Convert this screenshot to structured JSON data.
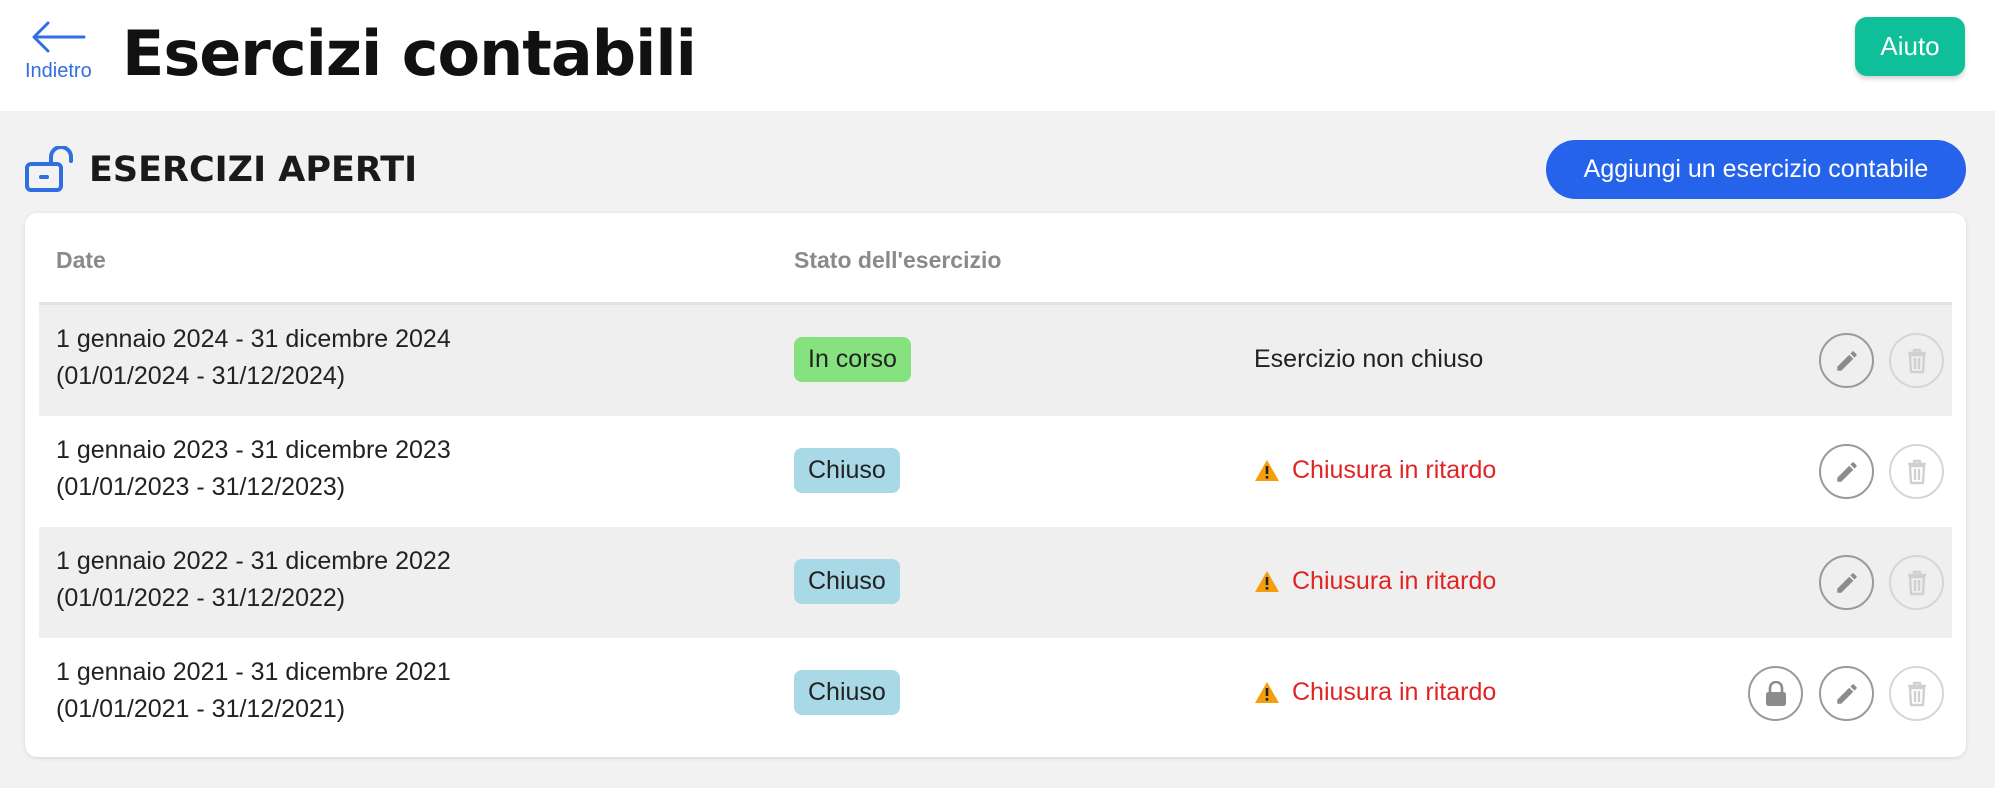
{
  "header": {
    "back_label": "Indietro",
    "title": "Esercizi contabili",
    "help_label": "Aiuto"
  },
  "section": {
    "title": "ESERCIZI APERTI",
    "add_button": "Aggiungi un esercizio contabile",
    "icon": "unlock-icon"
  },
  "table": {
    "headers": [
      "Date",
      "Stato dell'esercizio"
    ],
    "rows": [
      {
        "date_long": "1 gennaio 2024 - 31 dicembre 2024",
        "date_short": "(01/01/2024 - 31/12/2024)",
        "status": "In corso",
        "status_color": "#86e17f",
        "note": "Esercizio non chiuso",
        "warning": false,
        "lock": false
      },
      {
        "date_long": "1 gennaio 2023 - 31 dicembre 2023",
        "date_short": "(01/01/2023 - 31/12/2023)",
        "status": "Chiuso",
        "status_color": "#a9d8e6",
        "note": "Chiusura in ritardo",
        "warning": true,
        "lock": false
      },
      {
        "date_long": "1 gennaio 2022 - 31 dicembre 2022",
        "date_short": "(01/01/2022 - 31/12/2022)",
        "status": "Chiuso",
        "status_color": "#a9d8e6",
        "note": "Chiusura in ritardo",
        "warning": true,
        "lock": false
      },
      {
        "date_long": "1 gennaio 2021 - 31 dicembre 2021",
        "date_short": "(01/01/2021 - 31/12/2021)",
        "status": "Chiuso",
        "status_color": "#a9d8e6",
        "note": "Chiusura in ritardo",
        "warning": true,
        "lock": true
      }
    ]
  },
  "colors": {
    "accent": "#2563eb",
    "help": "#0fbf9a",
    "late": "#e02424",
    "warning_icon": "#f59e0b"
  }
}
